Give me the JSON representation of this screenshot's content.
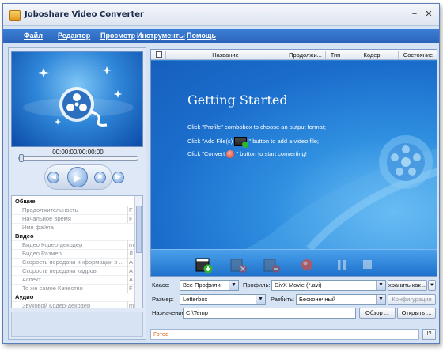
{
  "window": {
    "title": "Joboshare Video Converter"
  },
  "titlebar": {
    "minimize": "−",
    "close": "✕"
  },
  "menu": [
    "Файл",
    "Редактор",
    "Просмотр",
    "Инструменты",
    "Помощь"
  ],
  "player": {
    "time": "00:00:00/00:00:00"
  },
  "properties": [
    {
      "group": "Общие"
    },
    {
      "key": "Продолжительность",
      "value": "F"
    },
    {
      "key": "Начальное время",
      "value": "F"
    },
    {
      "key": "Имя файла",
      "value": ""
    },
    {
      "group": "Видео"
    },
    {
      "key": "Видео Кодер-декодер",
      "value": "m"
    },
    {
      "key": "Видео Размер",
      "value": "Л"
    },
    {
      "key": "Скорость передачи информации в ...",
      "value": "A"
    },
    {
      "key": "Скорость передачи кадров",
      "value": "A"
    },
    {
      "key": "Аспект",
      "value": "A"
    },
    {
      "key": "То же самое Качество",
      "value": "F"
    },
    {
      "group": "Аудио"
    },
    {
      "key": "Звуковой Кодер-декодер",
      "value": "m"
    }
  ],
  "list_header": {
    "name": "Название",
    "duration": "Продолжи...",
    "type": "Тип",
    "codec": "Кодер",
    "status": "Состояние"
  },
  "getting_started": {
    "title": "Getting Started",
    "line1": "Click \"Profile\" combobox to choose an output format;",
    "line2a": "Click \"Add File(s)",
    "line2b": "\" button to add a video file;",
    "line3a": "Click \"Convert",
    "line3b": "\" button to start converting!"
  },
  "form": {
    "class_label": "Класс:",
    "class_value": "Все Профили",
    "profile_label": "Профиль:",
    "profile_value": "DivX Movie  (*.avi)",
    "save_as_button": "хранить как ...",
    "size_label": "Размер:",
    "size_value": "Letterbox",
    "split_label": "Разбить:",
    "split_value": "Бесконечный",
    "config_button": "Конфигурация",
    "dest_label": "Назначение",
    "dest_value": "C:\\Temp",
    "browse_button": "Обзор ...",
    "open_button": "Открыть ...",
    "dropdown_glyph": "▼"
  },
  "status": {
    "text": "Готов",
    "help": "!?"
  },
  "colors": {
    "menubar": "#2a63b8",
    "accent": "#2b83d7",
    "status_text": "#e06a1a"
  }
}
